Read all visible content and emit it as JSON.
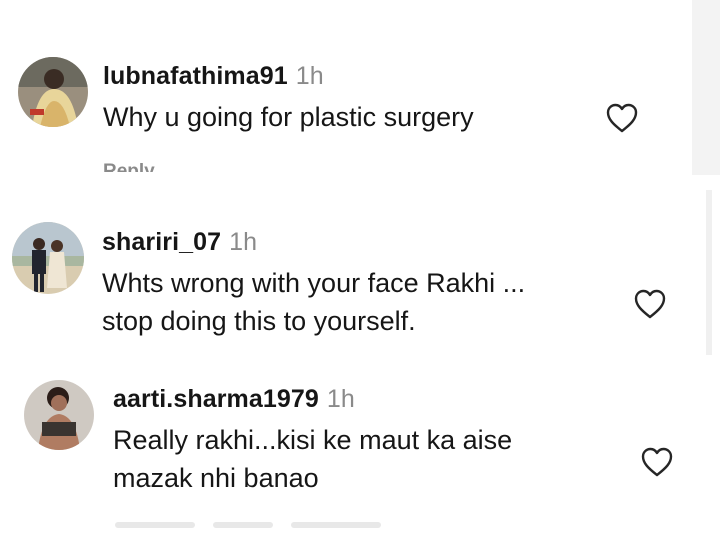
{
  "comments": [
    {
      "username": "lubnafathima91",
      "time": "1h",
      "lines": [
        "Why u going for plastic surgery"
      ],
      "reply_label": "Reply",
      "like_icon": "heart-outline-icon"
    },
    {
      "username": "shariri_07",
      "time": "1h",
      "lines": [
        "Whts wrong with your face Rakhi ...",
        "stop doing this to yourself."
      ],
      "like_icon": "heart-outline-icon"
    },
    {
      "username": "aarti.sharma1979",
      "time": "1h",
      "lines": [
        "Really rakhi...kisi ke maut ka aise",
        "mazak nhi banao"
      ],
      "like_icon": "heart-outline-icon"
    }
  ],
  "colors": {
    "text": "#161616",
    "muted": "#8a8a8a",
    "heart_stroke": "#262626"
  }
}
